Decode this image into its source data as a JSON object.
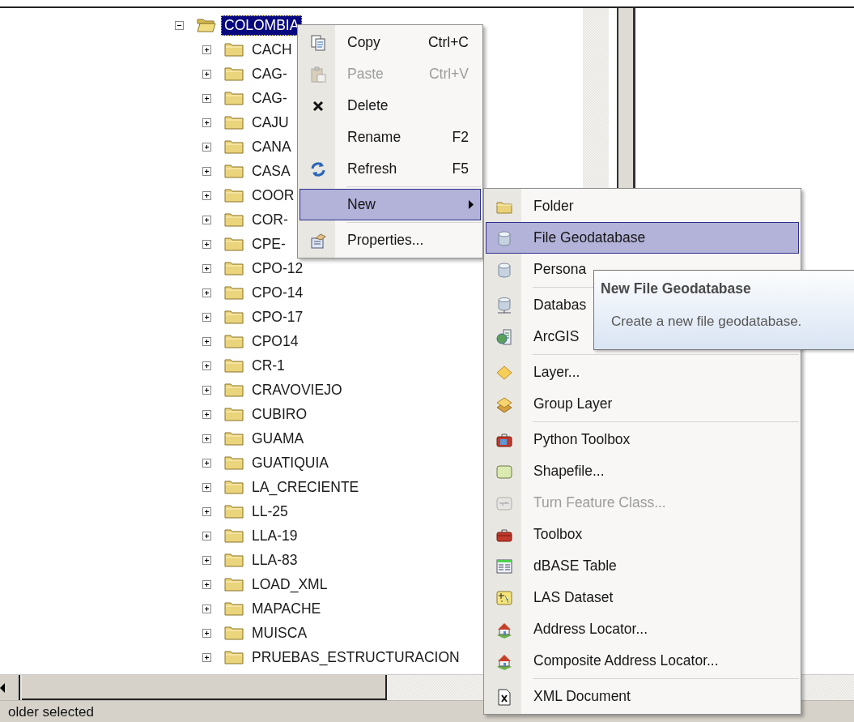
{
  "tree": {
    "root": {
      "label": "COLOMBIA",
      "expanded": true,
      "selected": true,
      "children": [
        {
          "label": "CACH",
          "expanded": false,
          "selected": false
        },
        {
          "label": "CAG-",
          "expanded": false,
          "selected": false
        },
        {
          "label": "CAG-",
          "expanded": false,
          "selected": false
        },
        {
          "label": "CAJU",
          "expanded": false,
          "selected": false
        },
        {
          "label": "CANA",
          "expanded": false,
          "selected": false
        },
        {
          "label": "CASA",
          "expanded": false,
          "selected": false
        },
        {
          "label": "COOR",
          "expanded": false,
          "selected": false
        },
        {
          "label": "COR-",
          "expanded": false,
          "selected": false
        },
        {
          "label": "CPE-",
          "expanded": false,
          "selected": false
        },
        {
          "label": "CPO-12",
          "expanded": false,
          "selected": false
        },
        {
          "label": "CPO-14",
          "expanded": false,
          "selected": false
        },
        {
          "label": "CPO-17",
          "expanded": false,
          "selected": false
        },
        {
          "label": "CPO14",
          "expanded": false,
          "selected": false
        },
        {
          "label": "CR-1",
          "expanded": false,
          "selected": false
        },
        {
          "label": "CRAVOVIEJO",
          "expanded": false,
          "selected": false
        },
        {
          "label": "CUBIRO",
          "expanded": false,
          "selected": false
        },
        {
          "label": "GUAMA",
          "expanded": false,
          "selected": false
        },
        {
          "label": "GUATIQUIA",
          "expanded": false,
          "selected": false
        },
        {
          "label": "LA_CRECIENTE",
          "expanded": false,
          "selected": false
        },
        {
          "label": "LL-25",
          "expanded": false,
          "selected": false
        },
        {
          "label": "LLA-19",
          "expanded": false,
          "selected": false
        },
        {
          "label": "LLA-83",
          "expanded": false,
          "selected": false
        },
        {
          "label": "LOAD_XML",
          "expanded": false,
          "selected": false
        },
        {
          "label": "MAPACHE",
          "expanded": false,
          "selected": false
        },
        {
          "label": "MUISCA",
          "expanded": false,
          "selected": false
        },
        {
          "label": "PRUEBAS_ESTRUCTURACION",
          "expanded": false,
          "selected": false
        }
      ]
    }
  },
  "context_menu": {
    "items": [
      {
        "kind": "item",
        "label": "Copy",
        "shortcut": "Ctrl+C",
        "disabled": false,
        "selected": false
      },
      {
        "kind": "item",
        "label": "Paste",
        "shortcut": "Ctrl+V",
        "disabled": true,
        "selected": false
      },
      {
        "kind": "item",
        "label": "Delete",
        "disabled": false,
        "selected": false
      },
      {
        "kind": "item",
        "label": "Rename",
        "shortcut": "F2",
        "disabled": false,
        "selected": false
      },
      {
        "kind": "item",
        "label": "Refresh",
        "shortcut": "F5",
        "disabled": false,
        "selected": false
      },
      {
        "kind": "separator"
      },
      {
        "kind": "submenu",
        "label": "New",
        "disabled": false,
        "selected": true
      },
      {
        "kind": "separator"
      },
      {
        "kind": "item",
        "label": "Properties...",
        "disabled": false,
        "selected": false
      }
    ]
  },
  "submenu": {
    "items": [
      {
        "kind": "item",
        "label": "Folder",
        "disabled": false,
        "selected": false
      },
      {
        "kind": "item",
        "label": "File Geodatabase",
        "disabled": false,
        "selected": true
      },
      {
        "kind": "item",
        "label": "Persona",
        "disabled": false,
        "selected": false
      },
      {
        "kind": "separator"
      },
      {
        "kind": "item",
        "label": "Databas",
        "disabled": false,
        "selected": false
      },
      {
        "kind": "item",
        "label": "ArcGIS",
        "disabled": false,
        "selected": false
      },
      {
        "kind": "separator"
      },
      {
        "kind": "item",
        "label": "Layer...",
        "disabled": false,
        "selected": false
      },
      {
        "kind": "item",
        "label": "Group Layer",
        "disabled": false,
        "selected": false
      },
      {
        "kind": "separator"
      },
      {
        "kind": "item",
        "label": "Python Toolbox",
        "disabled": false,
        "selected": false
      },
      {
        "kind": "item",
        "label": "Shapefile...",
        "disabled": false,
        "selected": false
      },
      {
        "kind": "item",
        "label": "Turn Feature Class...",
        "disabled": true,
        "selected": false
      },
      {
        "kind": "item",
        "label": "Toolbox",
        "disabled": false,
        "selected": false
      },
      {
        "kind": "item",
        "label": "dBASE Table",
        "disabled": false,
        "selected": false
      },
      {
        "kind": "item",
        "label": "LAS Dataset",
        "disabled": false,
        "selected": false
      },
      {
        "kind": "item",
        "label": "Address Locator...",
        "disabled": false,
        "selected": false
      },
      {
        "kind": "item",
        "label": "Composite Address Locator...",
        "disabled": false,
        "selected": false
      },
      {
        "kind": "separator"
      },
      {
        "kind": "item",
        "label": "XML Document",
        "disabled": false,
        "selected": false
      }
    ]
  },
  "tooltip": {
    "title": "New File Geodatabase",
    "text": "Create a new file geodatabase."
  },
  "status_bar": {
    "text": "older selected"
  }
}
